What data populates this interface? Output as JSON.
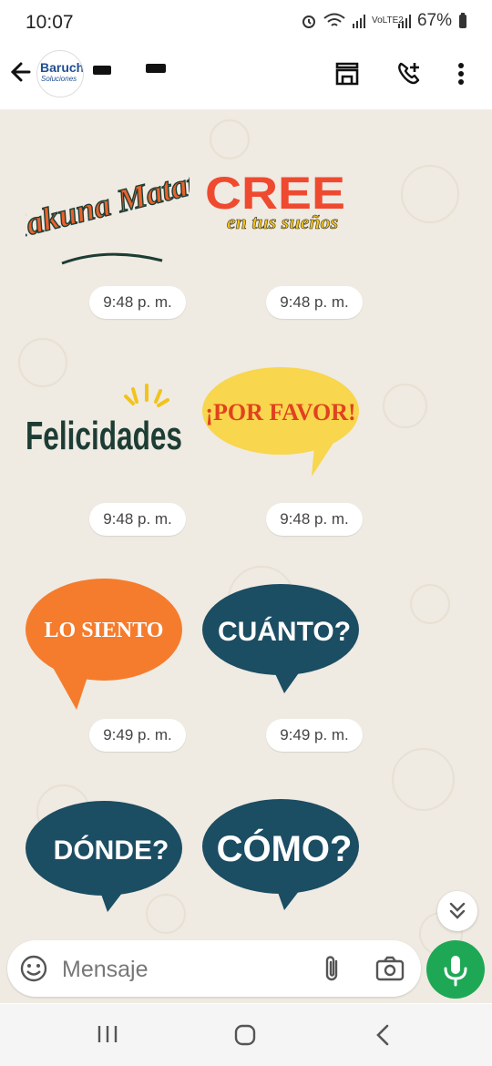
{
  "status": {
    "time": "10:07",
    "battery": "67%",
    "network": "VoLTE2"
  },
  "header": {
    "avatar_top": "Baruch",
    "avatar_bottom": "Soluciones"
  },
  "stickers": [
    {
      "text": "Hakuna Matata",
      "time": "9:48 p. m."
    },
    {
      "text": "CREE",
      "subtext": "en tus sueños",
      "time": "9:48 p. m."
    },
    {
      "text": "Felicidades",
      "time": "9:48 p. m."
    },
    {
      "text": "¡POR FAVOR!",
      "time": "9:48 p. m."
    },
    {
      "text": "LO SIENTO",
      "time": "9:49 p. m."
    },
    {
      "text": "CUÁNTO?",
      "time": "9:49 p. m."
    },
    {
      "text": "DÓNDE?",
      "time": ""
    },
    {
      "text": "CÓMO?",
      "time": ""
    }
  ],
  "composer": {
    "placeholder": "Mensaje"
  },
  "colors": {
    "accent_green": "#1ea855",
    "chat_bg": "#efeae2",
    "bubble_blue": "#1b4d63",
    "bubble_orange": "#f57c2c",
    "bubble_yellow": "#f8d64d"
  }
}
